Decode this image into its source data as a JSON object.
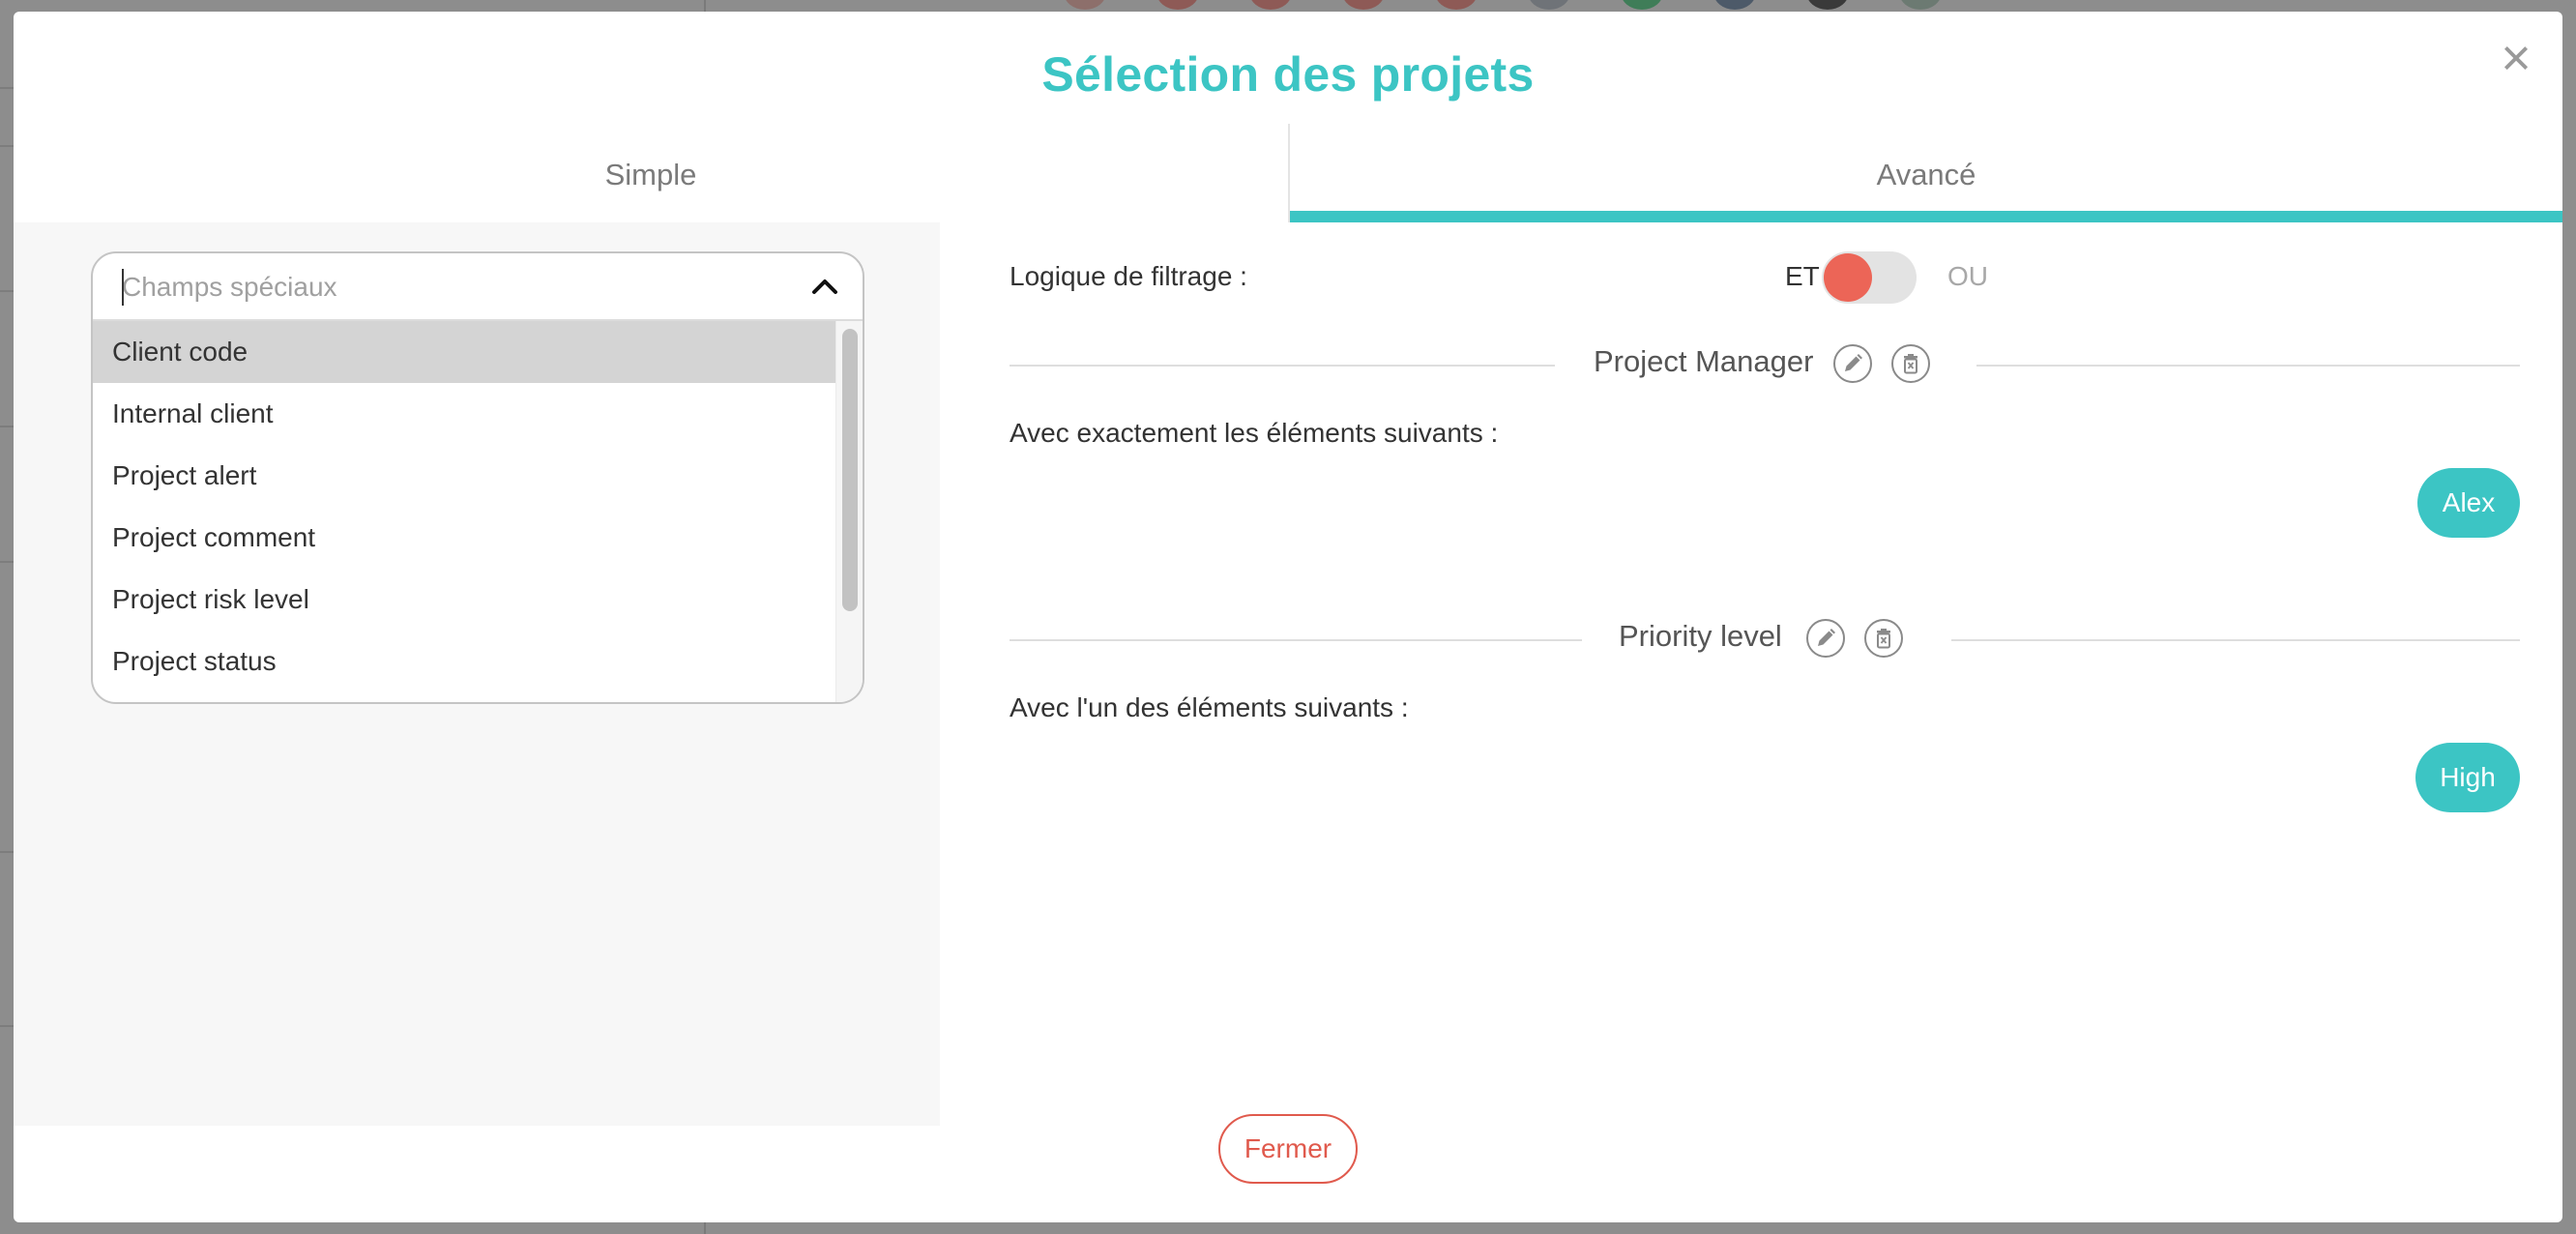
{
  "modal": {
    "title": "Sélection des projets",
    "close_symbol": "×",
    "footer_close_label": "Fermer"
  },
  "tabs": [
    {
      "label": "Simple",
      "active": false
    },
    {
      "label": "Avancé",
      "active": true
    }
  ],
  "dropdown": {
    "placeholder": "Champs spéciaux",
    "value": "",
    "options": [
      "Client code",
      "Internal client",
      "Project alert",
      "Project comment",
      "Project risk level",
      "Project status"
    ],
    "highlighted_index": 0
  },
  "filter_logic": {
    "label": "Logique de filtrage :",
    "option_and": "ET",
    "option_or": "OU",
    "selected": "ET"
  },
  "sections": [
    {
      "title": "Project Manager",
      "condition": "Avec exactement les éléments suivants :",
      "chips": [
        "Alex"
      ]
    },
    {
      "title": "Priority level",
      "condition": "Avec l'un des éléments suivants :",
      "chips": [
        "High"
      ]
    }
  ],
  "colors": {
    "accent": "#3cc5c4",
    "toggle_knob": "#ec6557",
    "close_button": "#e05a4d",
    "overlay": "#8d8d8d"
  },
  "icons": [
    "close-icon",
    "chevron-up-icon",
    "pencil-icon",
    "trash-icon"
  ]
}
